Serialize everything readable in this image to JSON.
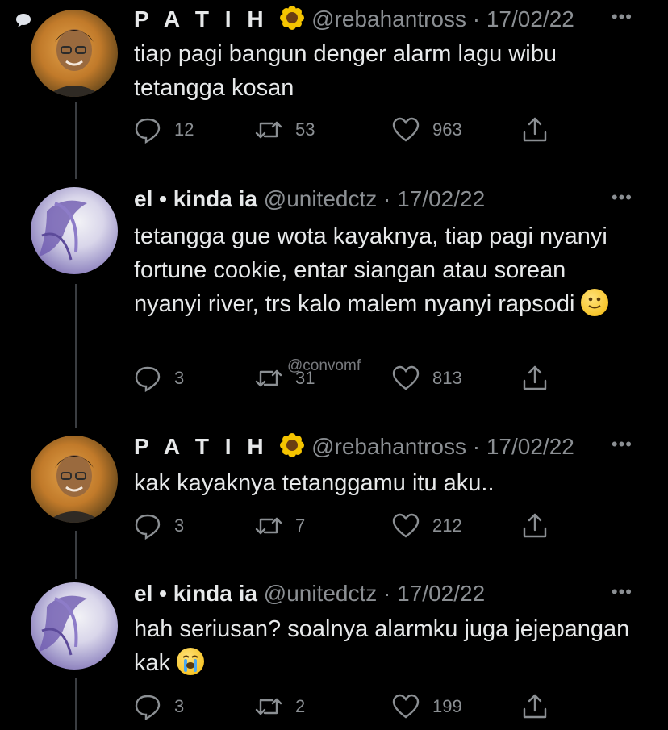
{
  "tweets": [
    {
      "name": "P A T I H",
      "handle": "@rebahantross",
      "separator": "·",
      "date": "17/02/22",
      "text": "tiap pagi bangun denger alarm lagu wibu tetangga kosan",
      "replies": "12",
      "retweets": "53",
      "likes": "963"
    },
    {
      "name": "el • kinda ia",
      "handle": "@unitedctz",
      "separator": "·",
      "date": "17/02/22",
      "text": "tetangga gue wota kayaknya, tiap pagi nyanyi fortune cookie, entar siangan atau sorean nyanyi river, trs kalo malem nyanyi rapsodi",
      "emoji": "smile-emoji",
      "replies": "3",
      "retweets": "31",
      "likes": "813"
    },
    {
      "name": "P A T I H",
      "handle": "@rebahantross",
      "separator": "·",
      "date": "17/02/22",
      "text": "kak kayaknya tetanggamu itu aku..",
      "replies": "3",
      "retweets": "7",
      "likes": "212"
    },
    {
      "name": "el • kinda ia",
      "handle": "@unitedctz",
      "separator": "·",
      "date": "17/02/22",
      "text": "hah seriusan? soalnya alarmku juga jejepangan kak",
      "emoji": "crying-emoji",
      "replies": "3",
      "retweets": "2",
      "likes": "199"
    }
  ],
  "more_label": "•••",
  "watermark": "@convomf",
  "icons": {
    "reply": "reply-icon",
    "retweet": "retweet-icon",
    "like": "heart-icon",
    "share": "share-icon",
    "more": "more-icon",
    "badge": "sunflower-icon"
  },
  "colors": {
    "background": "#000000",
    "text": "#e7e9ea",
    "secondary": "#8b8f93",
    "thread_line": "#3a3d41"
  }
}
